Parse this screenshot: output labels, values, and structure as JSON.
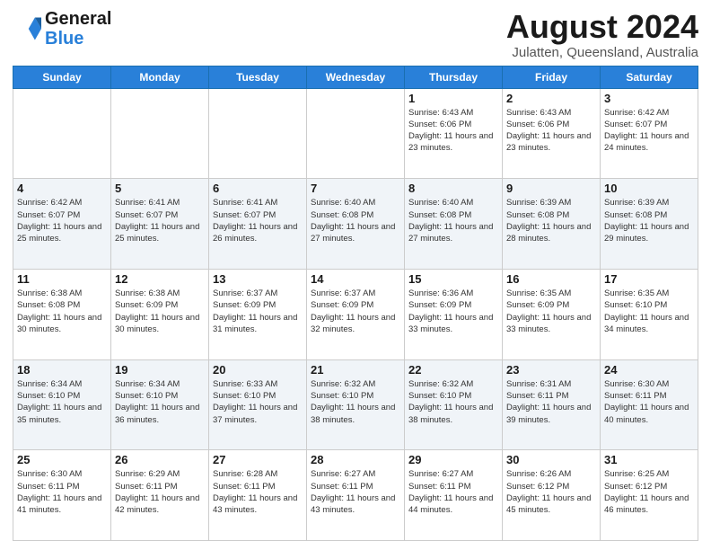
{
  "logo": {
    "line1": "General",
    "line2": "Blue"
  },
  "header": {
    "title": "August 2024",
    "location": "Julatten, Queensland, Australia"
  },
  "weekdays": [
    "Sunday",
    "Monday",
    "Tuesday",
    "Wednesday",
    "Thursday",
    "Friday",
    "Saturday"
  ],
  "weeks": [
    [
      {
        "day": "",
        "info": ""
      },
      {
        "day": "",
        "info": ""
      },
      {
        "day": "",
        "info": ""
      },
      {
        "day": "",
        "info": ""
      },
      {
        "day": "1",
        "info": "Sunrise: 6:43 AM\nSunset: 6:06 PM\nDaylight: 11 hours\nand 23 minutes."
      },
      {
        "day": "2",
        "info": "Sunrise: 6:43 AM\nSunset: 6:06 PM\nDaylight: 11 hours\nand 23 minutes."
      },
      {
        "day": "3",
        "info": "Sunrise: 6:42 AM\nSunset: 6:07 PM\nDaylight: 11 hours\nand 24 minutes."
      }
    ],
    [
      {
        "day": "4",
        "info": "Sunrise: 6:42 AM\nSunset: 6:07 PM\nDaylight: 11 hours\nand 25 minutes."
      },
      {
        "day": "5",
        "info": "Sunrise: 6:41 AM\nSunset: 6:07 PM\nDaylight: 11 hours\nand 25 minutes."
      },
      {
        "day": "6",
        "info": "Sunrise: 6:41 AM\nSunset: 6:07 PM\nDaylight: 11 hours\nand 26 minutes."
      },
      {
        "day": "7",
        "info": "Sunrise: 6:40 AM\nSunset: 6:08 PM\nDaylight: 11 hours\nand 27 minutes."
      },
      {
        "day": "8",
        "info": "Sunrise: 6:40 AM\nSunset: 6:08 PM\nDaylight: 11 hours\nand 27 minutes."
      },
      {
        "day": "9",
        "info": "Sunrise: 6:39 AM\nSunset: 6:08 PM\nDaylight: 11 hours\nand 28 minutes."
      },
      {
        "day": "10",
        "info": "Sunrise: 6:39 AM\nSunset: 6:08 PM\nDaylight: 11 hours\nand 29 minutes."
      }
    ],
    [
      {
        "day": "11",
        "info": "Sunrise: 6:38 AM\nSunset: 6:08 PM\nDaylight: 11 hours\nand 30 minutes."
      },
      {
        "day": "12",
        "info": "Sunrise: 6:38 AM\nSunset: 6:09 PM\nDaylight: 11 hours\nand 30 minutes."
      },
      {
        "day": "13",
        "info": "Sunrise: 6:37 AM\nSunset: 6:09 PM\nDaylight: 11 hours\nand 31 minutes."
      },
      {
        "day": "14",
        "info": "Sunrise: 6:37 AM\nSunset: 6:09 PM\nDaylight: 11 hours\nand 32 minutes."
      },
      {
        "day": "15",
        "info": "Sunrise: 6:36 AM\nSunset: 6:09 PM\nDaylight: 11 hours\nand 33 minutes."
      },
      {
        "day": "16",
        "info": "Sunrise: 6:35 AM\nSunset: 6:09 PM\nDaylight: 11 hours\nand 33 minutes."
      },
      {
        "day": "17",
        "info": "Sunrise: 6:35 AM\nSunset: 6:10 PM\nDaylight: 11 hours\nand 34 minutes."
      }
    ],
    [
      {
        "day": "18",
        "info": "Sunrise: 6:34 AM\nSunset: 6:10 PM\nDaylight: 11 hours\nand 35 minutes."
      },
      {
        "day": "19",
        "info": "Sunrise: 6:34 AM\nSunset: 6:10 PM\nDaylight: 11 hours\nand 36 minutes."
      },
      {
        "day": "20",
        "info": "Sunrise: 6:33 AM\nSunset: 6:10 PM\nDaylight: 11 hours\nand 37 minutes."
      },
      {
        "day": "21",
        "info": "Sunrise: 6:32 AM\nSunset: 6:10 PM\nDaylight: 11 hours\nand 38 minutes."
      },
      {
        "day": "22",
        "info": "Sunrise: 6:32 AM\nSunset: 6:10 PM\nDaylight: 11 hours\nand 38 minutes."
      },
      {
        "day": "23",
        "info": "Sunrise: 6:31 AM\nSunset: 6:11 PM\nDaylight: 11 hours\nand 39 minutes."
      },
      {
        "day": "24",
        "info": "Sunrise: 6:30 AM\nSunset: 6:11 PM\nDaylight: 11 hours\nand 40 minutes."
      }
    ],
    [
      {
        "day": "25",
        "info": "Sunrise: 6:30 AM\nSunset: 6:11 PM\nDaylight: 11 hours\nand 41 minutes."
      },
      {
        "day": "26",
        "info": "Sunrise: 6:29 AM\nSunset: 6:11 PM\nDaylight: 11 hours\nand 42 minutes."
      },
      {
        "day": "27",
        "info": "Sunrise: 6:28 AM\nSunset: 6:11 PM\nDaylight: 11 hours\nand 43 minutes."
      },
      {
        "day": "28",
        "info": "Sunrise: 6:27 AM\nSunset: 6:11 PM\nDaylight: 11 hours\nand 43 minutes."
      },
      {
        "day": "29",
        "info": "Sunrise: 6:27 AM\nSunset: 6:11 PM\nDaylight: 11 hours\nand 44 minutes."
      },
      {
        "day": "30",
        "info": "Sunrise: 6:26 AM\nSunset: 6:12 PM\nDaylight: 11 hours\nand 45 minutes."
      },
      {
        "day": "31",
        "info": "Sunrise: 6:25 AM\nSunset: 6:12 PM\nDaylight: 11 hours\nand 46 minutes."
      }
    ]
  ]
}
